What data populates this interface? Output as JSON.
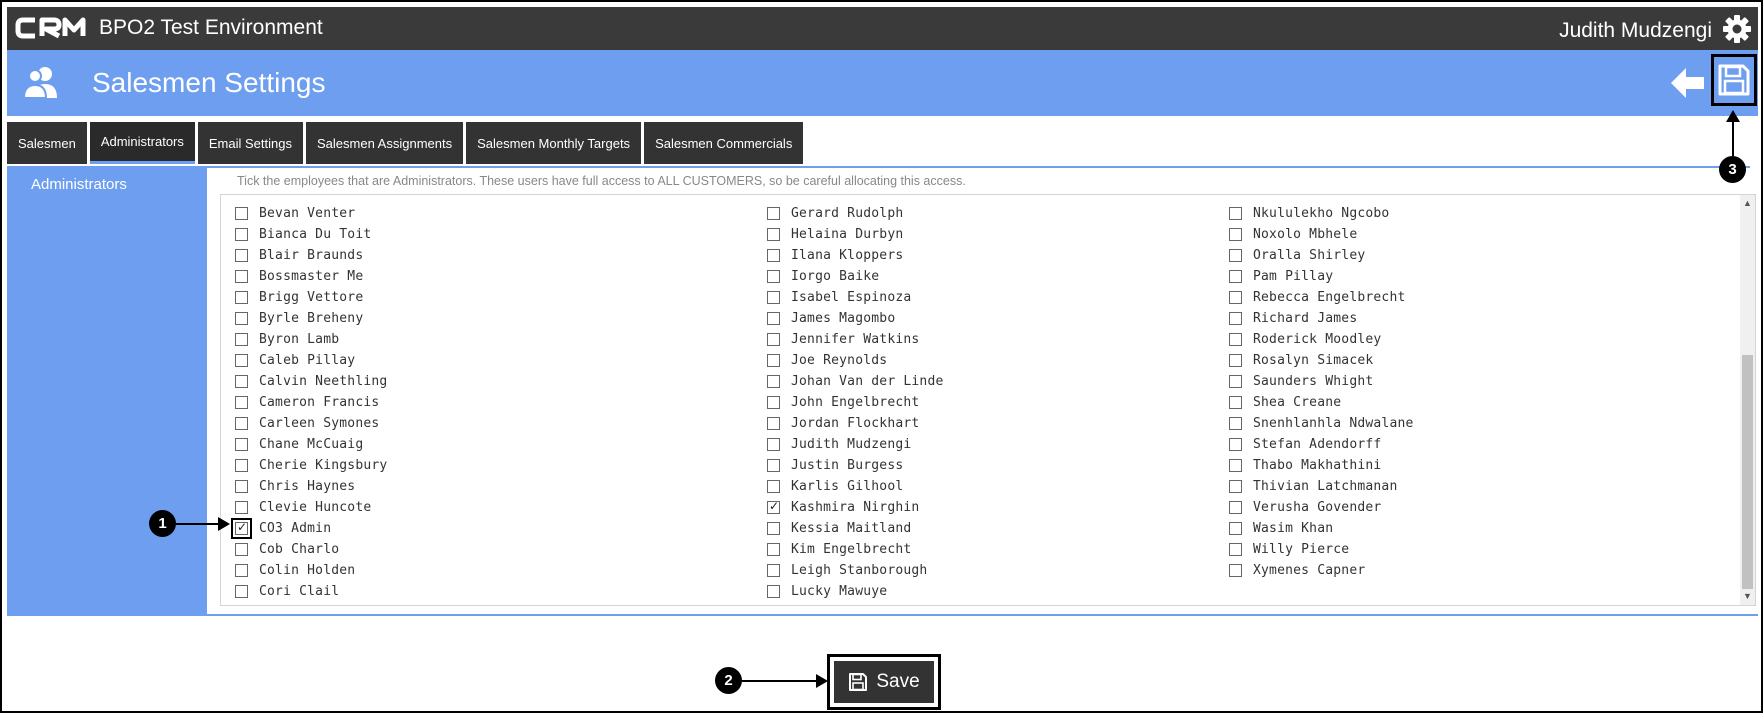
{
  "app": {
    "title": "BPO2 Test Environment",
    "user": "Judith Mudzengi"
  },
  "header": {
    "title": "Salesmen Settings"
  },
  "tabs": [
    {
      "label": "Salesmen"
    },
    {
      "label": "Administrators"
    },
    {
      "label": "Email Settings"
    },
    {
      "label": "Salesmen Assignments"
    },
    {
      "label": "Salesmen Monthly Targets"
    },
    {
      "label": "Salesmen Commercials"
    }
  ],
  "sidebar": {
    "item": "Administrators"
  },
  "hint": "Tick the employees that are Administrators. These users have full access to ALL CUSTOMERS, so be careful allocating this access.",
  "columns": [
    [
      {
        "name": "Bevan Venter",
        "checked": false
      },
      {
        "name": "Bianca Du Toit",
        "checked": false
      },
      {
        "name": "Blair Braunds",
        "checked": false
      },
      {
        "name": "Bossmaster Me",
        "checked": false
      },
      {
        "name": "Brigg Vettore",
        "checked": false
      },
      {
        "name": "Byrle Breheny",
        "checked": false
      },
      {
        "name": "Byron Lamb",
        "checked": false
      },
      {
        "name": "Caleb Pillay",
        "checked": false
      },
      {
        "name": "Calvin Neethling",
        "checked": false
      },
      {
        "name": "Cameron Francis",
        "checked": false
      },
      {
        "name": "Carleen Symones",
        "checked": false
      },
      {
        "name": "Chane McCuaig",
        "checked": false
      },
      {
        "name": "Cherie Kingsbury",
        "checked": false
      },
      {
        "name": "Chris Haynes",
        "checked": false
      },
      {
        "name": "Clevie Huncote",
        "checked": false
      },
      {
        "name": "CO3 Admin",
        "checked": true
      },
      {
        "name": "Cob Charlo",
        "checked": false
      },
      {
        "name": "Colin Holden",
        "checked": false
      },
      {
        "name": "Cori Clail",
        "checked": false
      }
    ],
    [
      {
        "name": "Gerard Rudolph",
        "checked": false
      },
      {
        "name": "Helaina Durbyn",
        "checked": false
      },
      {
        "name": "Ilana Kloppers",
        "checked": false
      },
      {
        "name": "Iorgo Baike",
        "checked": false
      },
      {
        "name": "Isabel Espinoza",
        "checked": false
      },
      {
        "name": "James Magombo",
        "checked": false
      },
      {
        "name": "Jennifer Watkins",
        "checked": false
      },
      {
        "name": "Joe Reynolds",
        "checked": false
      },
      {
        "name": "Johan Van der Linde",
        "checked": false
      },
      {
        "name": "John Engelbrecht",
        "checked": false
      },
      {
        "name": "Jordan Flockhart",
        "checked": false
      },
      {
        "name": "Judith Mudzengi",
        "checked": false
      },
      {
        "name": "Justin Burgess",
        "checked": false
      },
      {
        "name": "Karlis Gilhool",
        "checked": false
      },
      {
        "name": "Kashmira Nirghin",
        "checked": true
      },
      {
        "name": "Kessia Maitland",
        "checked": false
      },
      {
        "name": "Kim Engelbrecht",
        "checked": false
      },
      {
        "name": "Leigh Stanborough",
        "checked": false
      },
      {
        "name": "Lucky Mawuye",
        "checked": false
      }
    ],
    [
      {
        "name": "Nkululekho Ngcobo",
        "checked": false
      },
      {
        "name": "Noxolo Mbhele",
        "checked": false
      },
      {
        "name": "Oralla Shirley",
        "checked": false
      },
      {
        "name": "Pam Pillay",
        "checked": false
      },
      {
        "name": "Rebecca Engelbrecht",
        "checked": false
      },
      {
        "name": "Richard James",
        "checked": false
      },
      {
        "name": "Roderick Moodley",
        "checked": false
      },
      {
        "name": "Rosalyn Simacek",
        "checked": false
      },
      {
        "name": "Saunders Whight",
        "checked": false
      },
      {
        "name": "Shea Creane",
        "checked": false
      },
      {
        "name": "Snenhlanhla Ndwalane",
        "checked": false
      },
      {
        "name": "Stefan Adendorff",
        "checked": false
      },
      {
        "name": "Thabo Makhathini",
        "checked": false
      },
      {
        "name": "Thivian Latchmanan",
        "checked": false
      },
      {
        "name": "Verusha Govender",
        "checked": false
      },
      {
        "name": "Wasim Khan",
        "checked": false
      },
      {
        "name": "Willy Pierce",
        "checked": false
      },
      {
        "name": "Xymenes Capner",
        "checked": false
      }
    ]
  ],
  "save_button": {
    "label": "Save"
  },
  "callouts": [
    "1",
    "2",
    "3"
  ],
  "colors": {
    "topbar": "#3a3a3a",
    "accent": "#6d9ef0",
    "button": "#333333"
  },
  "icons": {
    "logo": "crm-logo",
    "settings": "gear-icon",
    "header": "users-icon",
    "back": "back-arrow-icon",
    "save": "floppy-disk-icon"
  }
}
